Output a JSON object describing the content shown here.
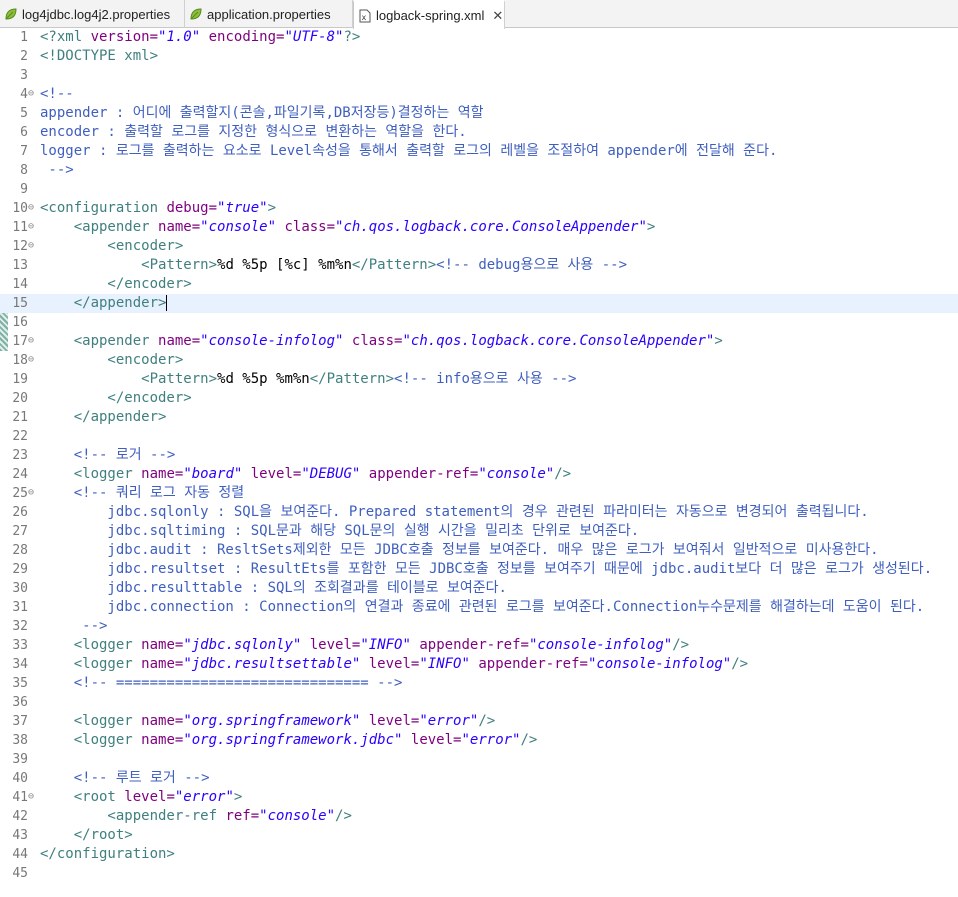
{
  "tabs": [
    {
      "label": "log4jdbc.log4j2.properties",
      "icon": "properties-leaf-icon",
      "active": false
    },
    {
      "label": "application.properties",
      "icon": "properties-leaf-icon",
      "active": false
    },
    {
      "label": "logback-spring.xml",
      "icon": "xml-file-icon",
      "active": true,
      "close": "✕"
    }
  ],
  "editor": {
    "current_line": 15,
    "lines": [
      {
        "n": "1",
        "fold": "",
        "seg": [
          [
            "tag",
            "<?xml "
          ],
          [
            "attr",
            "version="
          ],
          [
            "val",
            "\"1.0\""
          ],
          [
            "attr",
            " encoding="
          ],
          [
            "val",
            "\"UTF-8\""
          ],
          [
            "tag",
            "?>"
          ]
        ]
      },
      {
        "n": "2",
        "fold": "",
        "seg": [
          [
            "tag",
            "<!DOCTYPE xml>"
          ]
        ]
      },
      {
        "n": "3",
        "fold": "",
        "seg": []
      },
      {
        "n": "4",
        "fold": "⊖",
        "seg": [
          [
            "cmt",
            "<!--"
          ]
        ]
      },
      {
        "n": "5",
        "fold": "",
        "seg": [
          [
            "cmt",
            "appender : 어디에 출력할지(콘솔,파일기록,DB저장등)결정하는 역할"
          ]
        ]
      },
      {
        "n": "6",
        "fold": "",
        "seg": [
          [
            "cmt",
            "encoder : 출력할 로그를 지정한 형식으로 변환하는 역할을 한다."
          ]
        ]
      },
      {
        "n": "7",
        "fold": "",
        "seg": [
          [
            "cmt",
            "logger : 로그를 출력하는 요소로 Level속성을 통해서 출력할 로그의 레벨을 조절하여 appender에 전달해 준다."
          ]
        ]
      },
      {
        "n": "8",
        "fold": "",
        "seg": [
          [
            "cmt",
            " -->"
          ]
        ]
      },
      {
        "n": "9",
        "fold": "",
        "seg": []
      },
      {
        "n": "10",
        "fold": "⊖",
        "seg": [
          [
            "tag",
            "<configuration "
          ],
          [
            "attr",
            "debug="
          ],
          [
            "val",
            "\"true\""
          ],
          [
            "tag",
            ">"
          ]
        ]
      },
      {
        "n": "11",
        "fold": "⊖",
        "seg": [
          [
            "tag",
            "    <appender "
          ],
          [
            "attr",
            "name="
          ],
          [
            "val",
            "\"console\""
          ],
          [
            "attr",
            " class="
          ],
          [
            "val",
            "\"ch.qos.logback.core.ConsoleAppender\""
          ],
          [
            "tag",
            ">"
          ]
        ]
      },
      {
        "n": "12",
        "fold": "⊖",
        "seg": [
          [
            "tag",
            "        <encoder>"
          ]
        ]
      },
      {
        "n": "13",
        "fold": "",
        "seg": [
          [
            "tag",
            "            <Pattern>"
          ],
          [
            "ctext",
            "%d %5p [%c] %m%n"
          ],
          [
            "tag",
            "</Pattern>"
          ],
          [
            "cmt",
            "<!-- debug용으로 사용 -->"
          ]
        ]
      },
      {
        "n": "14",
        "fold": "",
        "seg": [
          [
            "tag",
            "        </encoder>"
          ]
        ]
      },
      {
        "n": "15",
        "fold": "",
        "seg": [
          [
            "tag",
            "    </appender>"
          ]
        ]
      },
      {
        "n": "16",
        "fold": "",
        "seg": []
      },
      {
        "n": "17",
        "fold": "⊖",
        "seg": [
          [
            "tag",
            "    <appender "
          ],
          [
            "attr",
            "name="
          ],
          [
            "val",
            "\"console-infolog\""
          ],
          [
            "attr",
            " class="
          ],
          [
            "val",
            "\"ch.qos.logback.core.ConsoleAppender\""
          ],
          [
            "tag",
            ">"
          ]
        ]
      },
      {
        "n": "18",
        "fold": "⊖",
        "seg": [
          [
            "tag",
            "        <encoder>"
          ]
        ]
      },
      {
        "n": "19",
        "fold": "",
        "seg": [
          [
            "tag",
            "            <Pattern>"
          ],
          [
            "ctext",
            "%d %5p %m%n"
          ],
          [
            "tag",
            "</Pattern>"
          ],
          [
            "cmt",
            "<!-- info용으로 사용 -->"
          ]
        ]
      },
      {
        "n": "20",
        "fold": "",
        "seg": [
          [
            "tag",
            "        </encoder>"
          ]
        ]
      },
      {
        "n": "21",
        "fold": "",
        "seg": [
          [
            "tag",
            "    </appender>"
          ]
        ]
      },
      {
        "n": "22",
        "fold": "",
        "seg": []
      },
      {
        "n": "23",
        "fold": "",
        "seg": [
          [
            "cmt",
            "    <!-- 로거 -->"
          ]
        ]
      },
      {
        "n": "24",
        "fold": "",
        "seg": [
          [
            "tag",
            "    <logger "
          ],
          [
            "attr",
            "name="
          ],
          [
            "val",
            "\"board\""
          ],
          [
            "attr",
            " level="
          ],
          [
            "val",
            "\"DEBUG\""
          ],
          [
            "attr",
            " appender-ref="
          ],
          [
            "val",
            "\"console\""
          ],
          [
            "tag",
            "/>"
          ]
        ]
      },
      {
        "n": "25",
        "fold": "⊖",
        "seg": [
          [
            "cmt",
            "    <!-- 쿼리 로그 자동 정렬"
          ]
        ]
      },
      {
        "n": "26",
        "fold": "",
        "seg": [
          [
            "cmt",
            "        jdbc.sqlonly : SQL을 보여준다. Prepared statement의 경우 관련된 파라미터는 자동으로 변경되어 출력됩니다."
          ]
        ]
      },
      {
        "n": "27",
        "fold": "",
        "seg": [
          [
            "cmt",
            "        jdbc.sqltiming : SQL문과 해당 SQL문의 실행 시간을 밀리초 단위로 보여준다."
          ]
        ]
      },
      {
        "n": "28",
        "fold": "",
        "seg": [
          [
            "cmt",
            "        jdbc.audit : ResltSets제외한 모든 JDBC호출 정보를 보여준다. 매우 많은 로그가 보여줘서 일반적으로 미사용한다."
          ]
        ]
      },
      {
        "n": "29",
        "fold": "",
        "seg": [
          [
            "cmt",
            "        jdbc.resultset : ResultEts를 포함한 모든 JDBC호출 정보를 보여주기 때문에 jdbc.audit보다 더 많은 로그가 생성된다."
          ]
        ]
      },
      {
        "n": "30",
        "fold": "",
        "seg": [
          [
            "cmt",
            "        jdbc.resulttable : SQL의 조회결과를 테이블로 보여준다."
          ]
        ]
      },
      {
        "n": "31",
        "fold": "",
        "seg": [
          [
            "cmt",
            "        jdbc.connection : Connection의 연결과 종료에 관련된 로그를 보여준다.Connection누수문제를 해결하는데 도움이 된다."
          ]
        ]
      },
      {
        "n": "32",
        "fold": "",
        "seg": [
          [
            "cmt",
            "     -->"
          ]
        ]
      },
      {
        "n": "33",
        "fold": "",
        "seg": [
          [
            "tag",
            "    <logger "
          ],
          [
            "attr",
            "name="
          ],
          [
            "val",
            "\"jdbc.sqlonly\""
          ],
          [
            "attr",
            " level="
          ],
          [
            "val",
            "\"INFO\""
          ],
          [
            "attr",
            " appender-ref="
          ],
          [
            "val",
            "\"console-infolog\""
          ],
          [
            "tag",
            "/>"
          ]
        ]
      },
      {
        "n": "34",
        "fold": "",
        "seg": [
          [
            "tag",
            "    <logger "
          ],
          [
            "attr",
            "name="
          ],
          [
            "val",
            "\"jdbc.resultsettable\""
          ],
          [
            "attr",
            " level="
          ],
          [
            "val",
            "\"INFO\""
          ],
          [
            "attr",
            " appender-ref="
          ],
          [
            "val",
            "\"console-infolog\""
          ],
          [
            "tag",
            "/>"
          ]
        ]
      },
      {
        "n": "35",
        "fold": "",
        "seg": [
          [
            "cmt",
            "    <!-- ============================== -->"
          ]
        ]
      },
      {
        "n": "36",
        "fold": "",
        "seg": []
      },
      {
        "n": "37",
        "fold": "",
        "seg": [
          [
            "tag",
            "    <logger "
          ],
          [
            "attr",
            "name="
          ],
          [
            "val",
            "\"org.springframework\""
          ],
          [
            "attr",
            " level="
          ],
          [
            "val",
            "\"error\""
          ],
          [
            "tag",
            "/>"
          ]
        ]
      },
      {
        "n": "38",
        "fold": "",
        "seg": [
          [
            "tag",
            "    <logger "
          ],
          [
            "attr",
            "name="
          ],
          [
            "val",
            "\"org.springframework.jdbc\""
          ],
          [
            "attr",
            " level="
          ],
          [
            "val",
            "\"error\""
          ],
          [
            "tag",
            "/>"
          ]
        ]
      },
      {
        "n": "39",
        "fold": "",
        "seg": []
      },
      {
        "n": "40",
        "fold": "",
        "seg": [
          [
            "cmt",
            "    <!-- 루트 로거 -->"
          ]
        ]
      },
      {
        "n": "41",
        "fold": "⊖",
        "seg": [
          [
            "tag",
            "    <root "
          ],
          [
            "attr",
            "level="
          ],
          [
            "val",
            "\"error\""
          ],
          [
            "tag",
            ">"
          ]
        ]
      },
      {
        "n": "42",
        "fold": "",
        "seg": [
          [
            "tag",
            "        <appender-ref "
          ],
          [
            "attr",
            "ref="
          ],
          [
            "val",
            "\"console\""
          ],
          [
            "tag",
            "/>"
          ]
        ]
      },
      {
        "n": "43",
        "fold": "",
        "seg": [
          [
            "tag",
            "    </root>"
          ]
        ]
      },
      {
        "n": "44",
        "fold": "",
        "seg": [
          [
            "tag",
            "</configuration>"
          ]
        ]
      },
      {
        "n": "45",
        "fold": "",
        "seg": []
      }
    ]
  }
}
